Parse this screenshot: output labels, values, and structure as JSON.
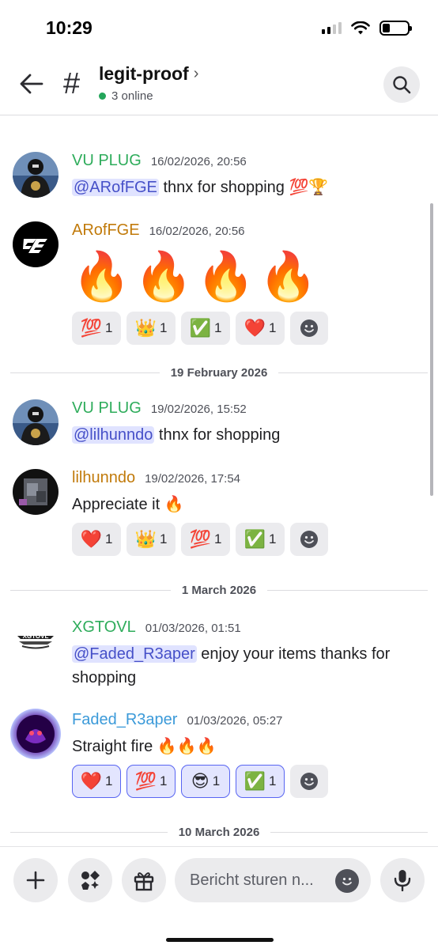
{
  "status_bar": {
    "time": "10:29",
    "battery_level": 0.3
  },
  "header": {
    "channel_prefix": "#",
    "channel_name": "legit-proof",
    "online_text": "3 online",
    "chevron": "›"
  },
  "messages": [
    {
      "author": "VU PLUG",
      "author_color": "#2eac5b",
      "timestamp": "16/02/2026, 20:56",
      "mention": "@ARofFGE",
      "text": " thnx for shopping 💯🏆"
    },
    {
      "author": "ARofFGE",
      "author_color": "#c17a0a",
      "timestamp": "16/02/2026, 20:56",
      "big_emoji": "🔥🔥🔥🔥",
      "reactions": [
        {
          "emoji": "💯",
          "count": "1"
        },
        {
          "emoji": "👑",
          "count": "1"
        },
        {
          "emoji": "✅",
          "count": "1"
        },
        {
          "emoji": "❤️",
          "count": "1"
        }
      ]
    },
    {
      "author": "VU PLUG",
      "author_color": "#2eac5b",
      "timestamp": "19/02/2026, 15:52",
      "mention": "@lilhunndo",
      "text": " thnx for shopping"
    },
    {
      "author": "lilhunndo",
      "author_color": "#c17a0a",
      "timestamp": "19/02/2026, 17:54",
      "text": "Appreciate it 🔥",
      "reactions": [
        {
          "emoji": "❤️",
          "count": "1"
        },
        {
          "emoji": "👑",
          "count": "1"
        },
        {
          "emoji": "💯",
          "count": "1"
        },
        {
          "emoji": "✅",
          "count": "1"
        }
      ]
    },
    {
      "author": "XGTOVL",
      "author_color": "#2eac5b",
      "timestamp": "01/03/2026, 01:51",
      "mention": "@Faded_R3aper",
      "text": " enjoy your items thanks for shopping"
    },
    {
      "author": "Faded_R3aper",
      "author_color": "#3b9ad9",
      "timestamp": "01/03/2026, 05:27",
      "text": "Straight fire 🔥🔥🔥",
      "reactions": [
        {
          "emoji": "❤️",
          "count": "1"
        },
        {
          "emoji": "💯",
          "count": "1"
        },
        {
          "emoji": "😎",
          "count": "1"
        },
        {
          "emoji": "✅",
          "count": "1"
        }
      ]
    }
  ],
  "dividers": [
    "19 February 2026",
    "1 March 2026",
    "10 March 2026"
  ],
  "composer": {
    "placeholder": "Bericht sturen n..."
  },
  "icons": {
    "back": "back-arrow-icon",
    "hash": "hash-icon",
    "search": "search-icon",
    "plus": "plus-icon",
    "apps": "apps-icon",
    "gift": "gift-icon",
    "emoji": "emoji-icon",
    "mic": "microphone-icon",
    "add_reaction": "add-reaction-icon"
  },
  "logo_text": "XGTOVL"
}
